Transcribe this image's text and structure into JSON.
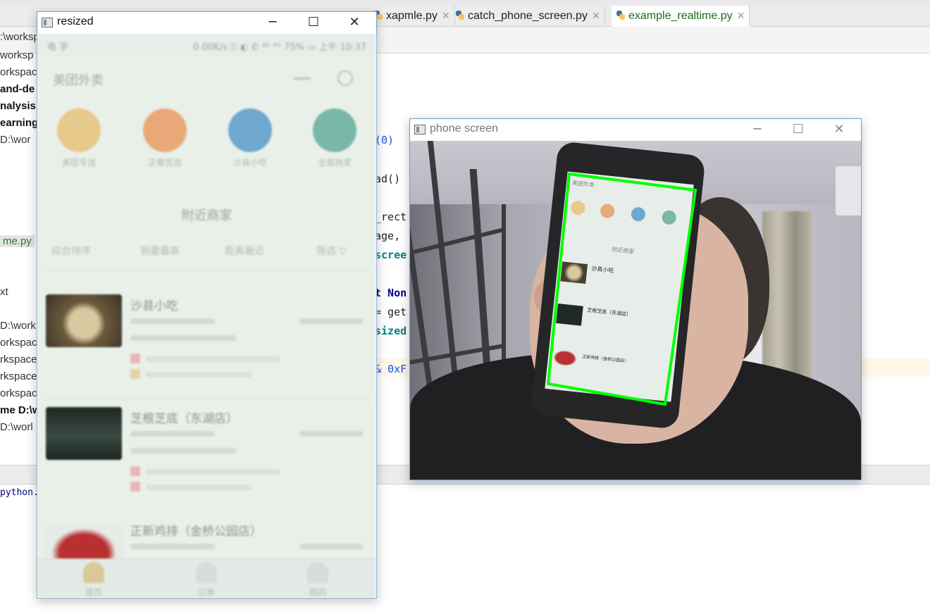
{
  "ide": {
    "tabs": [
      {
        "label": "xapmle.py",
        "active": false
      },
      {
        "label": "catch_phone_screen.py",
        "active": false
      },
      {
        "label": "example_realtime.py",
        "active": true
      }
    ],
    "project_lines": [
      {
        "text": ":\\worksp",
        "style": "normal"
      },
      {
        "text": "worksp",
        "style": "normal"
      },
      {
        "text": "orkspac",
        "style": "normal"
      },
      {
        "text": "and-de",
        "style": "bold"
      },
      {
        "text": "nalysis",
        "style": "bold"
      },
      {
        "text": "earning",
        "style": "bold"
      },
      {
        "text": " D:\\wor",
        "style": "normal"
      },
      {
        "text": "me.py",
        "style": "green"
      },
      {
        "text": "xt",
        "style": "normal"
      },
      {
        "text": " D:\\work",
        "style": "normal"
      },
      {
        "text": "orkspac",
        "style": "normal"
      },
      {
        "text": "rkspace",
        "style": "normal"
      },
      {
        "text": "rkspace",
        "style": "normal"
      },
      {
        "text": "orkspac",
        "style": "normal"
      },
      {
        "text": "me D:\\w",
        "style": "bold"
      },
      {
        "text": " D:\\worl",
        "style": "normal"
      }
    ],
    "code_lines": [
      {
        "text": "(0)",
        "style": "num"
      },
      {
        "text": "ad()",
        "style": "normal"
      },
      {
        "text": "_rect",
        "style": "normal"
      },
      {
        "text": "age,",
        "style": "normal"
      },
      {
        "text": "scree",
        "style": "bolditalic"
      },
      {
        "text": "t Non",
        "style": "kw"
      },
      {
        "text": "= get",
        "style": "normal"
      },
      {
        "text": "sized",
        "style": "bolditalic"
      },
      {
        "text": "& 0xF",
        "style": "num"
      }
    ],
    "console_text": "python."
  },
  "resized_window": {
    "title": "resized",
    "minimize": "─",
    "maximize": "☐",
    "close": "✕",
    "phone": {
      "status_left": "电 宇",
      "status_right": "0.00K/s ⚿ ◐ ✆ ⁴ᴳ ⁴ᴳ 75% ▭ 上午 10:37",
      "app_title": "美团外卖",
      "categories": [
        {
          "label": "美团专送",
          "color": "#e8c98c"
        },
        {
          "label": "正餐优选",
          "color": "#e9a978"
        },
        {
          "label": "沙县小吃",
          "color": "#6fa8cf"
        },
        {
          "label": "全部商家",
          "color": "#79b7a8"
        }
      ],
      "section_title": "附近商家",
      "filters": [
        "综合排序",
        "销量最高",
        "距离最近",
        "筛选 ▽"
      ],
      "stores": [
        {
          "name": "沙县小吃",
          "thumb_color": "#7a6a4a"
        },
        {
          "name": "芝根芝底（东湖店）",
          "thumb_color": "#2d3a33"
        },
        {
          "name": "正新鸡排（金桥公园店）",
          "thumb_color": "#9e2a2a"
        }
      ],
      "bottom_tabs": [
        "首页",
        "订单",
        "我的"
      ]
    }
  },
  "phone_window": {
    "title": "phone screen",
    "minimize": "─",
    "maximize": "☐",
    "close": "✕",
    "detection_color": "#00ff00",
    "mini_labels": {
      "app_title": "美团外卖",
      "section_title": "附近商家",
      "store1": "沙县小吃",
      "store2": "芝根芝底（东湖店）",
      "store3": "正新鸡排（金桥公园店）"
    }
  }
}
